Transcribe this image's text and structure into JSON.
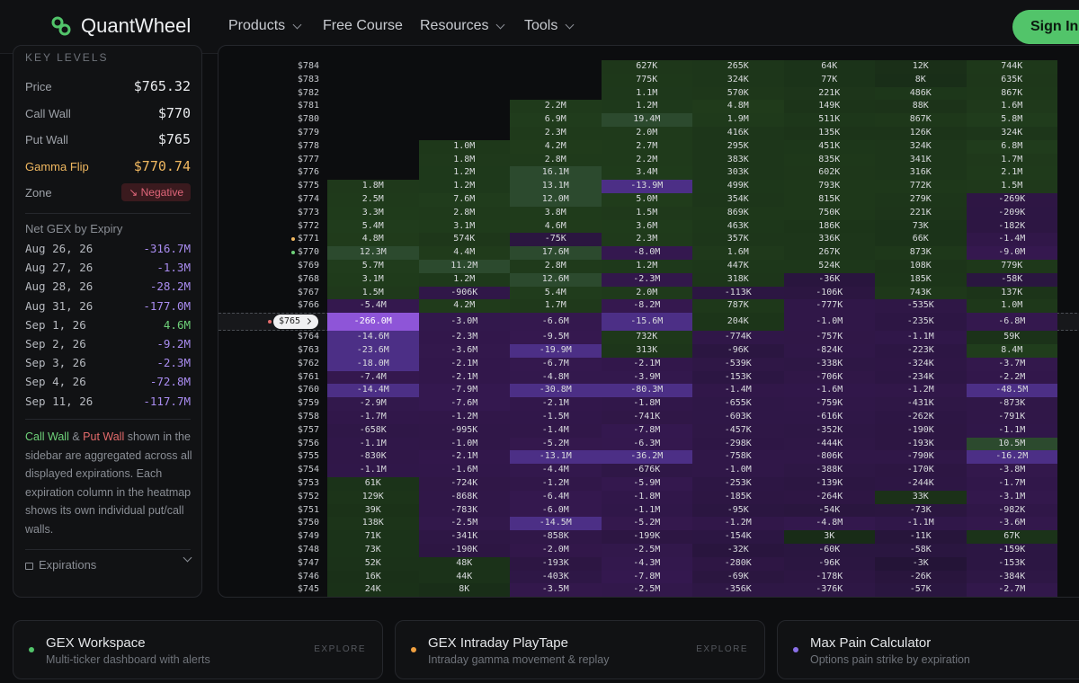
{
  "nav": {
    "brand": "QuantWheel",
    "items": [
      "Products",
      "Free Course",
      "Resources",
      "Tools"
    ],
    "signin": "Sign In"
  },
  "sidebar": {
    "section": "KEY LEVELS",
    "price_label": "Price",
    "price": "$765.32",
    "call_wall_label": "Call Wall",
    "call_wall": "$770",
    "put_wall_label": "Put Wall",
    "put_wall": "$765",
    "gamma_flip_label": "Gamma Flip",
    "gamma_flip": "$770.74",
    "zone_label": "Zone",
    "zone": "Negative",
    "expiry_heading": "Net GEX by Expiry",
    "expiries": [
      [
        "Aug 26, 26",
        "-316.7M"
      ],
      [
        "Aug 27, 26",
        "-1.3M"
      ],
      [
        "Aug 28, 26",
        "-28.2M"
      ],
      [
        "Aug 31, 26",
        "-177.0M"
      ],
      [
        "Sep 1, 26",
        "4.6M"
      ],
      [
        "Sep 2, 26",
        "-9.2M"
      ],
      [
        "Sep 3, 26",
        "-2.3M"
      ],
      [
        "Sep 4, 26",
        "-72.8M"
      ],
      [
        "Sep 11, 26",
        "-117.7M"
      ]
    ],
    "note_call": "Call Wall",
    "note_amp": " & ",
    "note_put": "Put Wall",
    "note_rest": " shown in the sidebar are aggregated across all displayed expirations. Each expiration column in the heatmap shows its own individual put/call walls.",
    "expirations_label": "Expirations"
  },
  "colors": {
    "accent": "#52c46a",
    "positive": "#6fd27a",
    "negative": "#a98cf0",
    "put": "#e36b6b",
    "gamma": "#f0b860"
  },
  "heatmap": {
    "current_tag": "$765",
    "rows": [
      [
        "$784",
        "",
        "",
        "",
        "627K",
        "265K",
        "64K",
        "12K",
        "744K"
      ],
      [
        "$783",
        "",
        "",
        "",
        "775K",
        "324K",
        "77K",
        "8K",
        "635K"
      ],
      [
        "$782",
        "",
        "",
        "",
        "1.1M",
        "570K",
        "221K",
        "486K",
        "867K"
      ],
      [
        "$781",
        "",
        "",
        "2.2M",
        "1.2M",
        "4.8M",
        "149K",
        "88K",
        "1.6M"
      ],
      [
        "$780",
        "",
        "",
        "6.9M",
        "19.4M",
        "1.9M",
        "511K",
        "867K",
        "5.8M"
      ],
      [
        "$779",
        "",
        "",
        "2.3M",
        "2.0M",
        "416K",
        "135K",
        "126K",
        "324K"
      ],
      [
        "$778",
        "",
        "1.0M",
        "4.2M",
        "2.7M",
        "295K",
        "451K",
        "324K",
        "6.8M"
      ],
      [
        "$777",
        "",
        "1.8M",
        "2.8M",
        "2.2M",
        "383K",
        "835K",
        "341K",
        "1.7M"
      ],
      [
        "$776",
        "",
        "1.2M",
        "16.1M",
        "3.4M",
        "303K",
        "602K",
        "316K",
        "2.1M"
      ],
      [
        "$775",
        "1.8M",
        "1.2M",
        "13.1M",
        "-13.9M",
        "499K",
        "793K",
        "772K",
        "1.5M"
      ],
      [
        "$774",
        "2.5M",
        "7.6M",
        "12.0M",
        "5.0M",
        "354K",
        "815K",
        "279K",
        "-269K"
      ],
      [
        "$773",
        "3.3M",
        "2.8M",
        "3.8M",
        "1.5M",
        "869K",
        "750K",
        "221K",
        "-209K"
      ],
      [
        "$772",
        "5.4M",
        "3.1M",
        "4.6M",
        "3.6M",
        "463K",
        "186K",
        "73K",
        "-182K"
      ],
      [
        "$771",
        "4.8M",
        "574K",
        "-75K",
        "2.3M",
        "357K",
        "336K",
        "66K",
        "-1.4M"
      ],
      [
        "$770",
        "12.3M",
        "4.4M",
        "17.6M",
        "-8.0M",
        "1.6M",
        "267K",
        "873K",
        "-9.0M"
      ],
      [
        "$769",
        "5.7M",
        "11.2M",
        "2.8M",
        "1.2M",
        "447K",
        "524K",
        "108K",
        "779K"
      ],
      [
        "$768",
        "3.1M",
        "1.2M",
        "12.6M",
        "-2.3M",
        "318K",
        "-36K",
        "185K",
        "-58K"
      ],
      [
        "$767",
        "1.5M",
        "-906K",
        "5.4M",
        "2.0M",
        "-113K",
        "-106K",
        "743K",
        "137K"
      ],
      [
        "$766",
        "-5.4M",
        "4.2M",
        "1.7M",
        "-8.2M",
        "787K",
        "-777K",
        "-535K",
        "1.0M"
      ],
      [
        "$765",
        "-266.0M",
        "-3.0M",
        "-6.6M",
        "-15.6M",
        "204K",
        "-1.0M",
        "-235K",
        "-6.8M"
      ],
      [
        "$764",
        "-14.6M",
        "-2.3M",
        "-9.5M",
        "732K",
        "-774K",
        "-757K",
        "-1.1M",
        "59K"
      ],
      [
        "$763",
        "-23.6M",
        "-3.6M",
        "-19.9M",
        "313K",
        "-96K",
        "-824K",
        "-223K",
        "8.4M"
      ],
      [
        "$762",
        "-18.0M",
        "-2.1M",
        "-6.7M",
        "-2.1M",
        "-539K",
        "-338K",
        "-324K",
        "-3.7M"
      ],
      [
        "$761",
        "-7.4M",
        "-2.1M",
        "-4.8M",
        "-3.9M",
        "-153K",
        "-706K",
        "-234K",
        "-2.2M"
      ],
      [
        "$760",
        "-14.4M",
        "-7.9M",
        "-30.8M",
        "-80.3M",
        "-1.4M",
        "-1.6M",
        "-1.2M",
        "-48.5M"
      ],
      [
        "$759",
        "-2.9M",
        "-7.6M",
        "-2.1M",
        "-1.8M",
        "-655K",
        "-759K",
        "-431K",
        "-873K"
      ],
      [
        "$758",
        "-1.7M",
        "-1.2M",
        "-1.5M",
        "-741K",
        "-603K",
        "-616K",
        "-262K",
        "-791K"
      ],
      [
        "$757",
        "-658K",
        "-995K",
        "-1.4M",
        "-7.8M",
        "-457K",
        "-352K",
        "-190K",
        "-1.1M"
      ],
      [
        "$756",
        "-1.1M",
        "-1.0M",
        "-5.2M",
        "-6.3M",
        "-298K",
        "-444K",
        "-193K",
        "10.5M"
      ],
      [
        "$755",
        "-830K",
        "-2.1M",
        "-13.1M",
        "-36.2M",
        "-758K",
        "-806K",
        "-790K",
        "-16.2M"
      ],
      [
        "$754",
        "-1.1M",
        "-1.6M",
        "-4.4M",
        "-676K",
        "-1.0M",
        "-388K",
        "-170K",
        "-3.8M"
      ],
      [
        "$753",
        "61K",
        "-724K",
        "-1.2M",
        "-5.9M",
        "-253K",
        "-139K",
        "-244K",
        "-1.7M"
      ],
      [
        "$752",
        "129K",
        "-868K",
        "-6.4M",
        "-1.8M",
        "-185K",
        "-264K",
        "33K",
        "-3.1M"
      ],
      [
        "$751",
        "39K",
        "-783K",
        "-6.0M",
        "-1.1M",
        "-95K",
        "-54K",
        "-73K",
        "-982K"
      ],
      [
        "$750",
        "138K",
        "-2.5M",
        "-14.5M",
        "-5.2M",
        "-1.2M",
        "-4.8M",
        "-1.1M",
        "-3.6M"
      ],
      [
        "$749",
        "71K",
        "-341K",
        "-858K",
        "-199K",
        "-154K",
        "3K",
        "-11K",
        "67K"
      ],
      [
        "$748",
        "73K",
        "-190K",
        "-2.0M",
        "-2.5M",
        "-32K",
        "-60K",
        "-58K",
        "-159K"
      ],
      [
        "$747",
        "52K",
        "48K",
        "-193K",
        "-4.3M",
        "-280K",
        "-96K",
        "-3K",
        "-153K"
      ],
      [
        "$746",
        "16K",
        "44K",
        "-403K",
        "-7.8M",
        "-69K",
        "-178K",
        "-26K",
        "-384K"
      ],
      [
        "$745",
        "24K",
        "8K",
        "-3.5M",
        "-2.5M",
        "-356K",
        "-376K",
        "-57K",
        "-2.7M"
      ]
    ]
  },
  "cards": [
    {
      "title": "GEX Workspace",
      "sub": "Multi-ticker dashboard with alerts",
      "cta": "EXPLORE",
      "dot": "#52c46a"
    },
    {
      "title": "GEX Intraday PlayTape",
      "sub": "Intraday gamma movement & replay",
      "cta": "EXPLORE",
      "dot": "#f0a040"
    },
    {
      "title": "Max Pain Calculator",
      "sub": "Options pain strike by expiration",
      "cta": "",
      "dot": "#8a70e8"
    }
  ]
}
